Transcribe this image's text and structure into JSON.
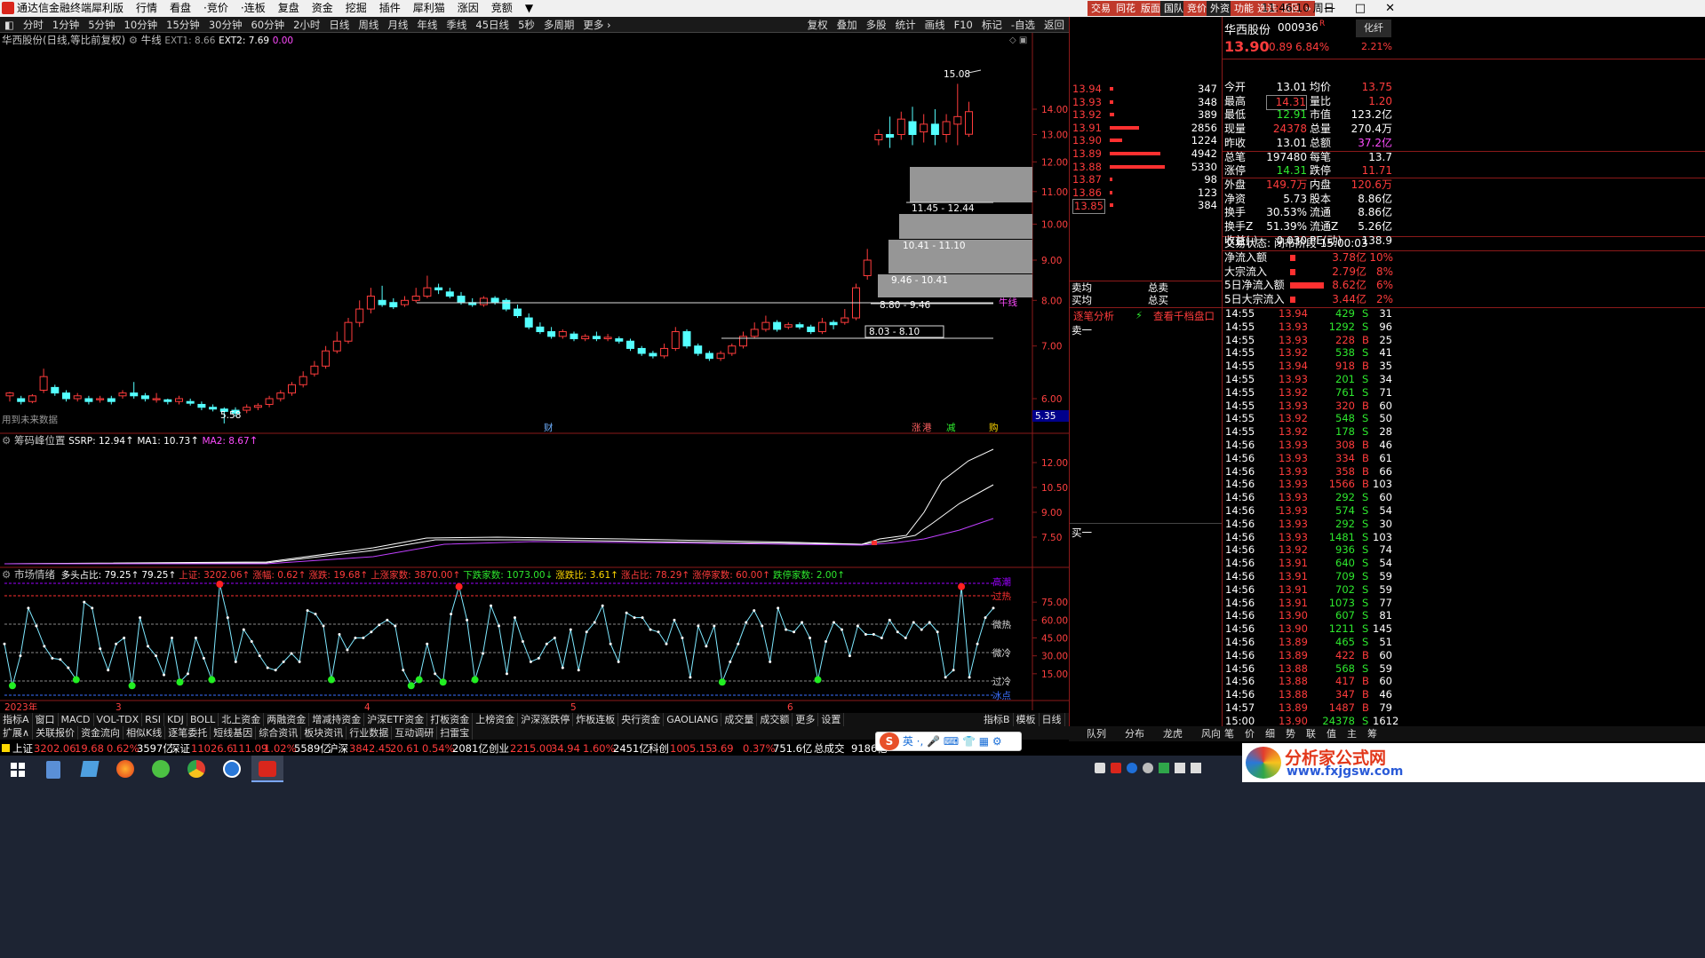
{
  "window": {
    "title": "通达信金融终端",
    "menu": [
      "犀利版",
      "行情",
      "看盘",
      "·竞价",
      "·连板",
      "复盘",
      "资金",
      "挖掘",
      "插件",
      "犀利猫",
      "涨因",
      "竞额",
      "▼"
    ],
    "right_tabs": [
      "交易",
      "同花",
      "版面",
      "国队",
      "竞价",
      "外资",
      "功能",
      "选选",
      "返回",
      "»"
    ],
    "clock": "11:46:10 周日",
    "controls": [
      "—",
      "□",
      "✕"
    ]
  },
  "periods": [
    "分时",
    "1分钟",
    "5分钟",
    "10分钟",
    "15分钟",
    "30分钟",
    "60分钟",
    "2小时",
    "日线",
    "周线",
    "月线",
    "年线",
    "季线",
    "45日线",
    "5秒",
    "多周期",
    "更多 ›"
  ],
  "tools": [
    "复权",
    "叠加",
    "多股",
    "统计",
    "画线",
    "F10",
    "标记",
    "-自选",
    "返回"
  ],
  "main_chart": {
    "title": "华西股份(日线,等比前复权)",
    "indicator": "牛线",
    "ext1": "EXT1: 8.66",
    "ext2": "EXT2: 7.69",
    "ext_extra": "0.00",
    "note": "用到未来数据",
    "high_label": "15.08",
    "low_label": "5.58",
    "niu_label": "牛线",
    "price_marker": "5.35",
    "event_cai": "财",
    "event_zhang": "涨",
    "event_gang": "港",
    "event_jian": "减",
    "event_gou": "购",
    "ticks": [
      "14.00",
      "13.00",
      "12.00",
      "11.00",
      "10.00",
      "9.00",
      "8.00",
      "7.00",
      "6.00"
    ],
    "chip_labels": [
      "11.45 - 12.44",
      "10.41 - 11.10",
      "9.46 - 10.41",
      "8.80 - 9.46",
      "8.03 - 8.10"
    ]
  },
  "chip_panel": {
    "title": "筹码峰位置",
    "ssrp": "SSRP: 12.94",
    "ma1": "MA1: 10.73",
    "ma2": "MA2: 8.67",
    "ticks": [
      "12.00",
      "10.50",
      "9.00",
      "7.50"
    ]
  },
  "sentiment_panel": {
    "title": "市场情绪",
    "items": [
      "多头占比: 79.25",
      "79.25",
      "上证: 3202.06",
      "涨幅: 0.62",
      "涨跌: 19.68",
      "上涨家数: 3870.00",
      "下跌家数: 1073.00",
      "涨跌比: 3.61",
      "涨占比: 78.29",
      "涨停家数: 60.00",
      "跌停家数: 2.00"
    ],
    "ticks": [
      "75.00",
      "60.00",
      "45.00",
      "30.00",
      "15.00"
    ],
    "zones": [
      "高潮",
      "过热",
      "微热",
      "微冷",
      "过冷",
      "冰点"
    ]
  },
  "xaxis": {
    "year": "2023年",
    "months": [
      "3",
      "4",
      "5",
      "6"
    ]
  },
  "bottom_tabs1": [
    "指标A",
    "窗口",
    "MACD",
    "VOL-TDX",
    "RSI",
    "KDJ",
    "BOLL",
    "北上资金",
    "两融资金",
    "增减持资金",
    "沪深ETF资金",
    "打板资金",
    "上榜资金",
    "沪深涨跌停",
    "炸板连板",
    "央行资金",
    "GAOLIANG",
    "成交量",
    "成交额",
    "更多",
    "设置"
  ],
  "bottom_tabs1_right": [
    "指标B",
    "模板",
    "日线"
  ],
  "bottom_tabs2": [
    "扩展∧",
    "关联报价",
    "资金流向",
    "相似K线",
    "逐笔委托",
    "短线基因",
    "综合资讯",
    "板块资讯",
    "行业数据",
    "互动调研",
    "扫雷宝"
  ],
  "right_bottom_tabs": [
    "队列",
    "分布",
    "龙虎",
    "风向",
    "笔",
    "价",
    "细",
    "势",
    "联",
    "值",
    "主",
    "筹"
  ],
  "indexbar": [
    {
      "name": "上证",
      "value": "3202.06",
      "chg": "19.68",
      "pct": "0.62%",
      "amt": "3597亿"
    },
    {
      "name": "深证",
      "value": "11026.6",
      "chg": "111.09",
      "pct": "1.02%",
      "amt": "5589亿"
    },
    {
      "name": "沪深",
      "value": "3842.45",
      "chg": "20.61",
      "pct": "0.54%",
      "amt": "2081亿"
    },
    {
      "name": "创业",
      "value": "2215.00",
      "chg": "34.94",
      "pct": "1.60%",
      "amt": "2451亿"
    },
    {
      "name": "科创",
      "value": "1005.15",
      "chg": "3.69",
      "pct": "0.37%",
      "amt": "751.6亿"
    }
  ],
  "index_extra": {
    "label": "总成交",
    "value": "9186亿"
  },
  "stock": {
    "name": "华西股份",
    "code": "000936",
    "suffix": "R",
    "price": "13.90",
    "chg": "0.89",
    "pct": "6.84%",
    "badge": "化纤",
    "badge_pct": "2.21%"
  },
  "quote": [
    [
      "今开",
      "13.01",
      "均价",
      "13.75"
    ],
    [
      "最高",
      "14.31",
      "量比",
      "1.20"
    ],
    [
      "最低",
      "12.91",
      "市值",
      "123.2亿"
    ],
    [
      "现量",
      "24378",
      "总量",
      "270.4万"
    ],
    [
      "昨收",
      "13.01",
      "总额",
      "37.2亿"
    ],
    [
      "总笔",
      "197480",
      "每笔",
      "13.7"
    ],
    [
      "涨停",
      "14.31",
      "跌停",
      "11.71"
    ],
    [
      "外盘",
      "149.7万",
      "内盘",
      "120.6万"
    ],
    [
      "净资",
      "5.73",
      "股本",
      "8.86亿"
    ],
    [
      "换手",
      "30.53%",
      "流通",
      "8.86亿"
    ],
    [
      "换手Z",
      "51.39%",
      "流通Z",
      "5.26亿"
    ],
    [
      "收益(-)",
      "0.030",
      "PE(动)",
      "138.9"
    ]
  ],
  "trade_status": "交易状态: 闭市阶段 15:00:03",
  "flows": [
    [
      "净流入额",
      "3.78亿",
      "10%"
    ],
    [
      "大宗流入",
      "2.79亿",
      "8%"
    ],
    [
      "5日净流入额",
      "8.62亿",
      "6%"
    ],
    [
      "5日大宗流入",
      "3.44亿",
      "2%"
    ]
  ],
  "orderbook": [
    [
      "13.94",
      "347"
    ],
    [
      "13.93",
      "348"
    ],
    [
      "13.92",
      "389"
    ],
    [
      "13.91",
      "2856"
    ],
    [
      "13.90",
      "1224"
    ],
    [
      "13.89",
      "4942"
    ],
    [
      "13.88",
      "5330"
    ],
    [
      "13.87",
      "98"
    ],
    [
      "13.86",
      "123"
    ],
    [
      "13.85",
      "384"
    ]
  ],
  "order_summary": {
    "sell_avg": "卖均",
    "buy_avg": "买均",
    "total_sell": "总卖",
    "total_buy": "总买",
    "tab1": "逐笔分析",
    "tab2": "查看千档盘口",
    "sell1": "卖一",
    "buy1": "买一"
  },
  "ticks": [
    [
      "14:55",
      "13.94",
      "429",
      "S",
      "31"
    ],
    [
      "14:55",
      "13.93",
      "1292",
      "S",
      "96"
    ],
    [
      "14:55",
      "13.93",
      "228",
      "B",
      "25"
    ],
    [
      "14:55",
      "13.92",
      "538",
      "S",
      "41"
    ],
    [
      "14:55",
      "13.94",
      "918",
      "B",
      "35"
    ],
    [
      "14:55",
      "13.93",
      "201",
      "S",
      "34"
    ],
    [
      "14:55",
      "13.92",
      "761",
      "S",
      "71"
    ],
    [
      "14:55",
      "13.93",
      "320",
      "B",
      "60"
    ],
    [
      "14:55",
      "13.92",
      "548",
      "S",
      "50"
    ],
    [
      "14:55",
      "13.92",
      "178",
      "S",
      "28"
    ],
    [
      "14:56",
      "13.93",
      "308",
      "B",
      "46"
    ],
    [
      "14:56",
      "13.93",
      "334",
      "B",
      "61"
    ],
    [
      "14:56",
      "13.93",
      "358",
      "B",
      "66"
    ],
    [
      "14:56",
      "13.93",
      "1566",
      "B",
      "103"
    ],
    [
      "14:56",
      "13.93",
      "292",
      "S",
      "60"
    ],
    [
      "14:56",
      "13.93",
      "574",
      "S",
      "54"
    ],
    [
      "14:56",
      "13.93",
      "292",
      "S",
      "30"
    ],
    [
      "14:56",
      "13.93",
      "1481",
      "S",
      "103"
    ],
    [
      "14:56",
      "13.92",
      "936",
      "S",
      "74"
    ],
    [
      "14:56",
      "13.91",
      "640",
      "S",
      "54"
    ],
    [
      "14:56",
      "13.91",
      "709",
      "S",
      "59"
    ],
    [
      "14:56",
      "13.91",
      "702",
      "S",
      "59"
    ],
    [
      "14:56",
      "13.91",
      "1073",
      "S",
      "77"
    ],
    [
      "14:56",
      "13.90",
      "607",
      "S",
      "81"
    ],
    [
      "14:56",
      "13.90",
      "1211",
      "S",
      "145"
    ],
    [
      "14:56",
      "13.89",
      "465",
      "S",
      "51"
    ],
    [
      "14:56",
      "13.89",
      "422",
      "B",
      "60"
    ],
    [
      "14:56",
      "13.88",
      "568",
      "S",
      "59"
    ],
    [
      "14:56",
      "13.88",
      "417",
      "B",
      "60"
    ],
    [
      "14:56",
      "13.88",
      "347",
      "B",
      "46"
    ],
    [
      "14:57",
      "13.89",
      "1487",
      "B",
      "79"
    ],
    [
      "15:00",
      "13.90",
      "24378",
      "S",
      "1612"
    ]
  ],
  "watermark": {
    "line1": "分析家公式网",
    "line2": "www.fxjgsw.com"
  }
}
